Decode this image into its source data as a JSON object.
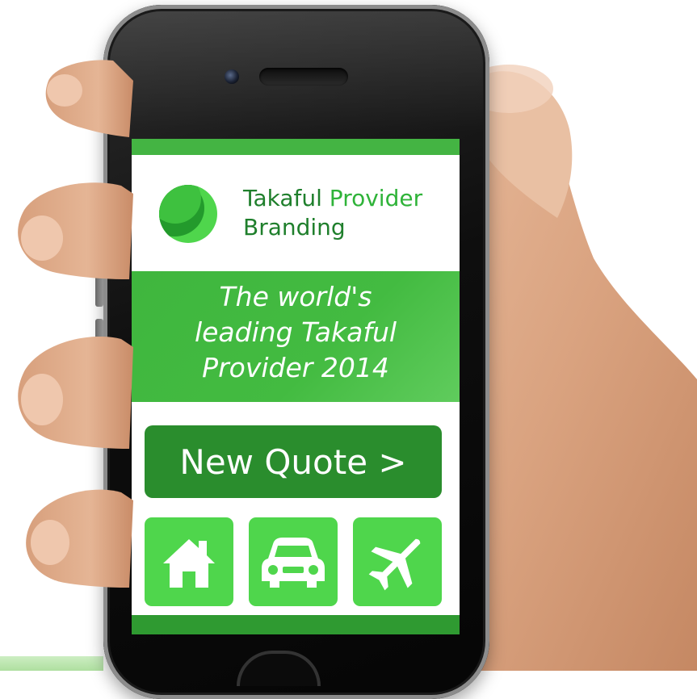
{
  "brand": {
    "name_part1": "Takaful",
    "name_part2": "Provider",
    "name_line2": "Branding",
    "logo": "crescent-circle-logo"
  },
  "hero": {
    "line1": "The world's",
    "line2": "leading Takaful",
    "line3": "Provider 2014"
  },
  "cta": {
    "label": "New Quote >"
  },
  "tiles": [
    {
      "icon": "home-icon"
    },
    {
      "icon": "car-icon"
    },
    {
      "icon": "airplane-icon"
    }
  ],
  "colors": {
    "primary_green": "#44b443",
    "dark_green": "#2a8d2d",
    "light_green": "#4fd64c",
    "brand_text": "#1f7f2c"
  }
}
